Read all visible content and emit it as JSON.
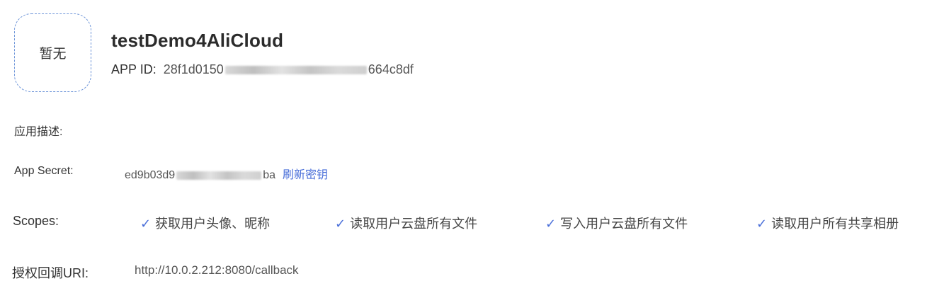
{
  "avatar": {
    "placeholder": "暂无"
  },
  "app": {
    "name": "testDemo4AliCloud",
    "app_id_label": "APP ID:",
    "app_id_start": "28f1d0150",
    "app_id_end": "664c8df"
  },
  "description": {
    "label": "应用描述:"
  },
  "secret": {
    "label": "App Secret:",
    "value_start": "ed9b03d9",
    "value_end": "ba",
    "refresh_label": "刷新密钥"
  },
  "scopes": {
    "label": "Scopes:",
    "items": [
      {
        "label": "获取用户头像、昵称",
        "checked": true
      },
      {
        "label": "读取用户云盘所有文件",
        "checked": true
      },
      {
        "label": "写入用户云盘所有文件",
        "checked": true
      },
      {
        "label": "读取用户所有共享相册",
        "checked": true
      }
    ]
  },
  "callback": {
    "label": "授权回调URI:",
    "value": "http://10.0.2.212:8080/callback"
  },
  "colors": {
    "accent": "#4a6fd9",
    "dashed_border": "#6b93d8"
  },
  "icons": {
    "scope_check": "check-icon"
  }
}
